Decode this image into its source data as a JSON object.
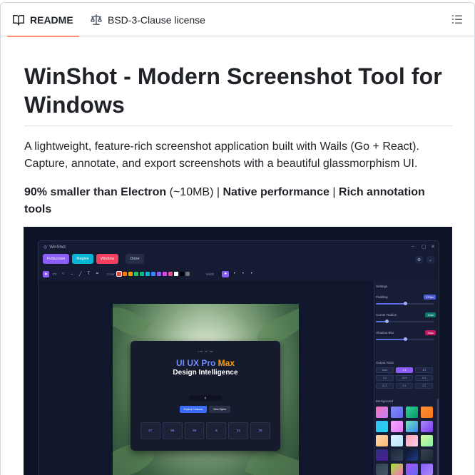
{
  "tabs": {
    "readme": "README",
    "license": "BSD-3-Clause license"
  },
  "article": {
    "title": "WinShot - Modern Screenshot Tool for Windows",
    "lead": "A lightweight, feature-rich screenshot application built with Wails (Go + React). Capture, annotate, and export screenshots with a beautiful glassmorphism UI.",
    "highlight_1": "90% smaller than Electron",
    "highlight_1_note": " (~10MB) | ",
    "highlight_2": "Native performance",
    "sep": " | ",
    "highlight_3": "Rich annotation tools"
  },
  "screenshot": {
    "app_title": "WinShot",
    "modes": [
      {
        "label": "Fullscreen",
        "color": "#8b5cf6"
      },
      {
        "label": "Region",
        "color": "#06b6d4"
      },
      {
        "label": "Window",
        "color": "#f43f5e"
      }
    ],
    "done_label": "Done",
    "color_label": "Color",
    "width_label": "Width",
    "palette": [
      "#ef4444",
      "#f97316",
      "#f59e0b",
      "#22c55e",
      "#10b981",
      "#06b6d4",
      "#3b82f6",
      "#8b5cf6",
      "#d946ef",
      "#ec4899",
      "#ffffff",
      "#000000",
      "#6b7280"
    ],
    "card": {
      "title_a": "UI UX Pro ",
      "title_b": "Max",
      "subtitle": "Design Intelligence",
      "primary_cta": "Explore Features",
      "secondary_cta": "View Styles",
      "stats": [
        "57",
        "96",
        "98",
        "8",
        "24",
        "29"
      ]
    },
    "settings": {
      "heading": "Settings",
      "padding_label": "Padding",
      "padding_value": "370px",
      "padding_pct": 0.5,
      "radius_label": "Corner Radius",
      "radius_value": "12px",
      "radius_pct": 0.18,
      "shadow_label": "Shadow Blur",
      "shadow_value": "34px",
      "shadow_pct": 0.5,
      "ratio_label": "Output Ratio",
      "ratios": [
        "Auto",
        "1:1",
        "4:3",
        "3:2",
        "16:9",
        "5:4",
        "21:9",
        "2:1",
        "2:3"
      ],
      "active_ratio": 1,
      "bg_label": "Background",
      "backgrounds": [
        "linear-gradient(135deg,#f472b6,#c084fc)",
        "linear-gradient(135deg,#818cf8,#6366f1)",
        "linear-gradient(135deg,#34d399,#059669)",
        "linear-gradient(135deg,#fb923c,#f97316)",
        "linear-gradient(135deg,#38bdf8,#22d3ee)",
        "linear-gradient(135deg,#f0abfc,#e879f9)",
        "linear-gradient(135deg,#6ee7b7,#3b82f6)",
        "linear-gradient(135deg,#a78bfa,#7c3aed)",
        "linear-gradient(135deg,#fed7aa,#fdba74)",
        "linear-gradient(135deg,#e0f2fe,#bae6fd)",
        "linear-gradient(135deg,#fda4af,#fbcfe8)",
        "linear-gradient(135deg,#d9f99d,#86efac)",
        "linear-gradient(135deg,#312e81,#4c1d95)",
        "linear-gradient(135deg,#1e293b,#334155)",
        "linear-gradient(135deg,#0f172a,#1e3a8a)",
        "linear-gradient(135deg,#374151,#1f2937)",
        "linear-gradient(135deg,#334155,#475569)",
        "linear-gradient(135deg,#a3e635,#f472b6)",
        "linear-gradient(135deg,#a855f7,#6366f1)",
        "linear-gradient(135deg,#8b5cf6,#a78bfa)",
        "linear-gradient(135deg,#10b981,#06b6d4)",
        "linear-gradient(135deg,#0ea5e9,#2563eb)",
        "linear-gradient(135deg,#f43f5e,#fb7185)",
        "linear-gradient(135deg,#f8fafc,#cbd5e1)"
      ]
    }
  }
}
